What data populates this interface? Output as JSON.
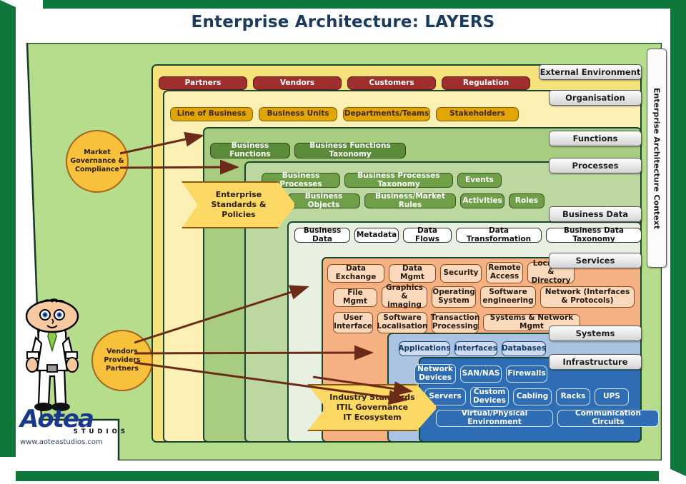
{
  "title": "Enterprise Architecture: LAYERS",
  "context_label": "Enterprise Architecture Context",
  "layer_tabs": [
    {
      "name": "External Environment"
    },
    {
      "name": "Organisation"
    },
    {
      "name": "Functions"
    },
    {
      "name": "Processes"
    },
    {
      "name": "Business Data"
    },
    {
      "name": "Services"
    },
    {
      "name": "Systems"
    },
    {
      "name": "Infrastructure"
    }
  ],
  "layers": {
    "external_environment": {
      "label": "External Environment",
      "color": "#f6e27a",
      "items": [
        "Partners",
        "Vendors",
        "Customers",
        "Regulation"
      ]
    },
    "organisation": {
      "label": "Organisation",
      "color": "#fcf0b4",
      "items": [
        "Line of Business",
        "Business Units",
        "Departments/Teams",
        "Stakeholders"
      ]
    },
    "functions": {
      "label": "Functions",
      "color": "#a8cc80",
      "items": [
        "Business Functions",
        "Business Functions Taxonomy"
      ]
    },
    "processes": {
      "label": "Processes",
      "color": "#bcd8a0",
      "items": [
        "Business Processes",
        "Business Processes Taxonomy",
        "Events",
        "Business Objects",
        "Business/Market  Rules",
        "Activities",
        "Roles"
      ]
    },
    "business_data": {
      "label": "Business Data",
      "color": "#e8f0e2",
      "items": [
        "Business Data",
        "Metadata",
        "Data Flows",
        "Data Transformation",
        "Business Data Taxonomy"
      ]
    },
    "services": {
      "label": "Services",
      "color": "#f6b183",
      "items": [
        "Data Exchange",
        "Data Mgmt",
        "Security",
        "Remote Access",
        "Location & Directory",
        "File Mgmt",
        "Graphics & imaging",
        "Operating System",
        "Software engineering",
        "Network (Interfaces & Protocols)",
        "User Interface",
        "Software Localisation",
        "Transaction Processing",
        "Systems & Network Mgmt"
      ]
    },
    "systems": {
      "label": "Systems",
      "color": "#a9c3e0",
      "items": [
        "Applications",
        "Interfaces",
        "Databases"
      ]
    },
    "infrastructure": {
      "label": "Infrastructure",
      "color": "#2e6db4",
      "items": [
        "Network Devices",
        "SAN/NAS",
        "Firewalls",
        "Servers",
        "Custom Devices",
        "Cabling",
        "Racks",
        "UPS",
        "Virtual/Physical Environment",
        "Communication Circuits"
      ]
    }
  },
  "callouts": {
    "market": "Market\nGovernance &\nCompliance",
    "market_lines": [
      "Market",
      "Governance &",
      "Compliance"
    ],
    "vendors": "Vendors\nProviders\nPartners",
    "vendors_lines": [
      "Vendors",
      "Providers",
      "Partners"
    ],
    "enterprise_standards_lines": [
      "Enterprise",
      "Standards &",
      "Policies"
    ],
    "industry_standards_lines": [
      "Industry Standards",
      "ITIL Governance",
      "IT Ecosystem"
    ]
  },
  "branding": {
    "name": "Aotea",
    "tagline": "STUDIOS",
    "url": "www.aoteastudios.com"
  },
  "colors": {
    "frame_green": "#10773c",
    "canvas_green": "#b5dd8c",
    "title_color": "#1b3a5c",
    "arrow_brown": "#6b2b18",
    "accent_gold": "#f7c13c"
  }
}
